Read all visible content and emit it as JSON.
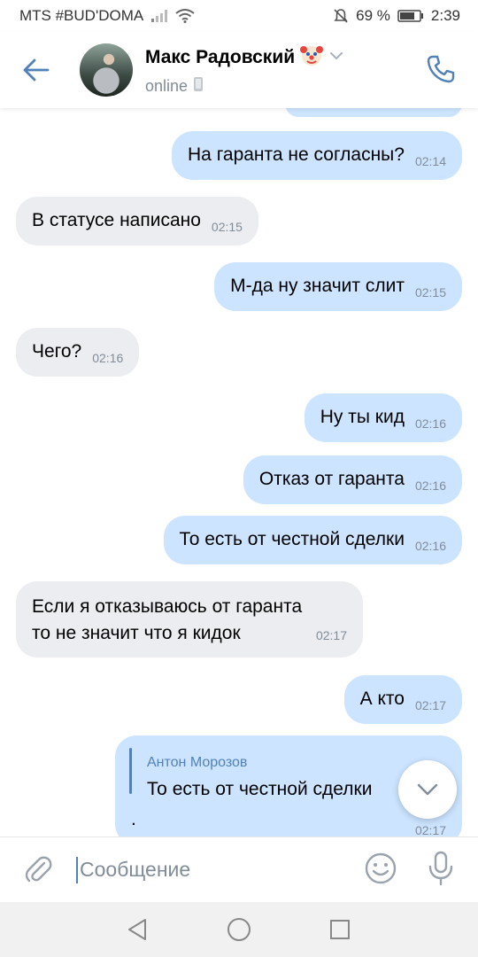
{
  "status_bar": {
    "carrier": "MTS #BUD'DOMA",
    "battery": "69 %",
    "time": "2:39"
  },
  "header": {
    "contact_name": "Макс Радовский",
    "contact_status": "online",
    "emoji_badge": "clown-face",
    "icons": [
      "back-arrow-icon",
      "chevron-down-icon",
      "mobile-icon",
      "phone-icon"
    ]
  },
  "messages": [
    {
      "direction": "out",
      "text": "На гаранта не согласны?",
      "time": "02:14"
    },
    {
      "direction": "in",
      "text": "В статусе написано",
      "time": "02:15"
    },
    {
      "direction": "out",
      "text": "М-да ну значит слит",
      "time": "02:15"
    },
    {
      "direction": "in",
      "text": "Чего?",
      "time": "02:16"
    },
    {
      "direction": "out",
      "text": "Ну ты кид",
      "time": "02:16"
    },
    {
      "direction": "out",
      "text": "Отказ от гаранта",
      "time": "02:16"
    },
    {
      "direction": "out",
      "text": "То есть от честной сделки",
      "time": "02:16"
    },
    {
      "direction": "in",
      "lines": [
        "Если я отказываюсь от гаранта",
        "то не значит что я кидок"
      ],
      "time": "02:17"
    },
    {
      "direction": "out",
      "text": "А кто",
      "time": "02:17"
    },
    {
      "direction": "out",
      "reply_author": "Антон Морозов",
      "reply_text": "То есть от честной сделки",
      "text": ".",
      "time": "02:17"
    }
  ],
  "composer": {
    "placeholder": "Сообщение"
  },
  "colors": {
    "accent": "#5181b8",
    "outgoing_bubble": "#cce4ff",
    "incoming_bubble": "#ebedf0",
    "secondary_text": "#818c99"
  }
}
